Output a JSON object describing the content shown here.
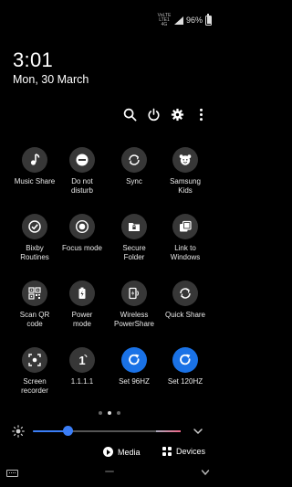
{
  "status_bar": {
    "network_label": "VoLTE LTE1 4G",
    "battery_text": "96%",
    "battery_level": 0.96
  },
  "clock": {
    "time": "3:01",
    "date": "Mon, 30 March"
  },
  "header_actions": [
    {
      "name": "search-icon"
    },
    {
      "name": "power-icon"
    },
    {
      "name": "gear-icon"
    },
    {
      "name": "more-icon"
    }
  ],
  "tiles": [
    {
      "label": "Music Share",
      "icon": "music-share-icon",
      "on": false
    },
    {
      "label": "Do not\ndisturb",
      "icon": "do-not-disturb-icon",
      "on": false
    },
    {
      "label": "Sync",
      "icon": "sync-icon",
      "on": false
    },
    {
      "label": "Samsung\nKids",
      "icon": "samsung-kids-icon",
      "on": false
    },
    {
      "label": "Bixby\nRoutines",
      "icon": "bixby-routines-icon",
      "on": false
    },
    {
      "label": "Focus mode",
      "icon": "focus-mode-icon",
      "on": false
    },
    {
      "label": "Secure\nFolder",
      "icon": "secure-folder-icon",
      "on": false
    },
    {
      "label": "Link to\nWindows",
      "icon": "link-to-windows-icon",
      "on": false
    },
    {
      "label": "Scan QR\ncode",
      "icon": "qr-code-icon",
      "on": false
    },
    {
      "label": "Power\nmode",
      "icon": "battery-icon",
      "on": false
    },
    {
      "label": "Wireless\nPowerShare",
      "icon": "wireless-powershare-icon",
      "on": false
    },
    {
      "label": "Quick Share",
      "icon": "quick-share-icon",
      "on": false
    },
    {
      "label": "Screen\nrecorder",
      "icon": "screen-recorder-icon",
      "on": false
    },
    {
      "label": "1.1.1.1",
      "icon": "cloudflare-1111-icon",
      "on": false
    },
    {
      "label": "Set 96HZ",
      "icon": "refresh-icon",
      "on": true
    },
    {
      "label": "Set 120HZ",
      "icon": "refresh-icon",
      "on": true
    }
  ],
  "pager": {
    "pages": 3,
    "current": 2
  },
  "brightness": {
    "level": 0.24
  },
  "media": {
    "media_label": "Media",
    "devices_label": "Devices"
  },
  "colors": {
    "accent": "#3b7ef7",
    "tile_on": "#1a72e6",
    "tile_off": "#373737",
    "background": "#000000"
  }
}
